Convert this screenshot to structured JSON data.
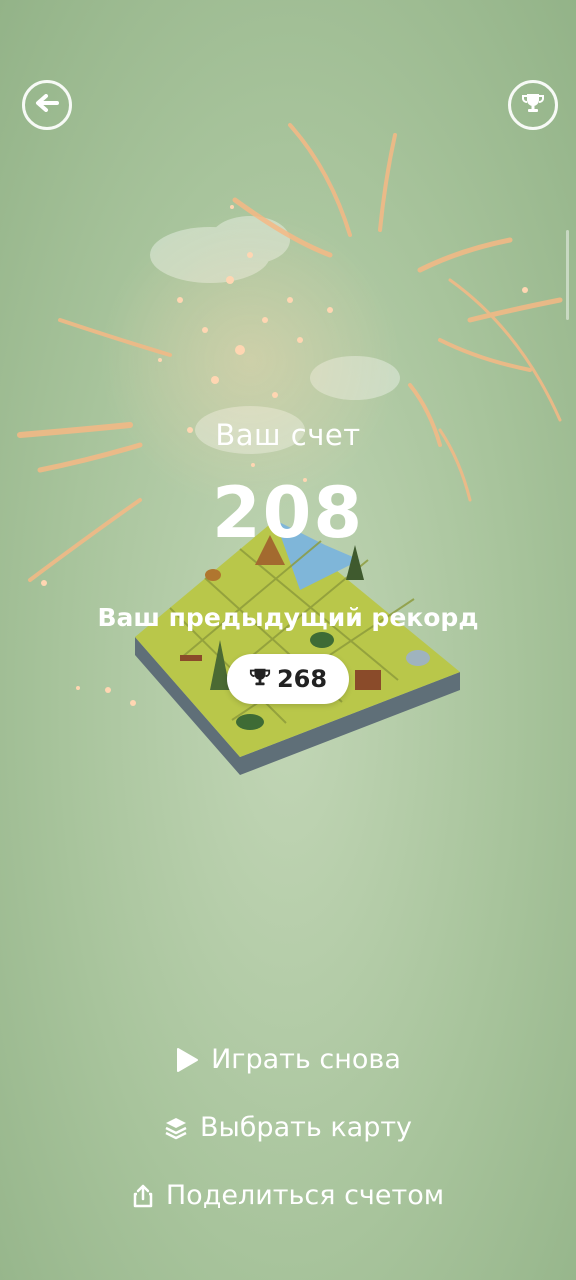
{
  "header": {
    "back_icon": "arrow-left-icon",
    "trophy_icon": "trophy-icon"
  },
  "score": {
    "title": "Ваш счет",
    "value": "208"
  },
  "record": {
    "label": "Ваш предыдущий рекорд",
    "icon": "trophy-icon",
    "value": "268"
  },
  "menu": {
    "play_again": "Играть снова",
    "choose_map": "Выбрать карту",
    "share": "Поделиться счетом"
  },
  "colors": {
    "background": "#a8c49c",
    "grass": "#b9c74a",
    "water": "#7fb6d9",
    "firework": "#f3b27a"
  }
}
